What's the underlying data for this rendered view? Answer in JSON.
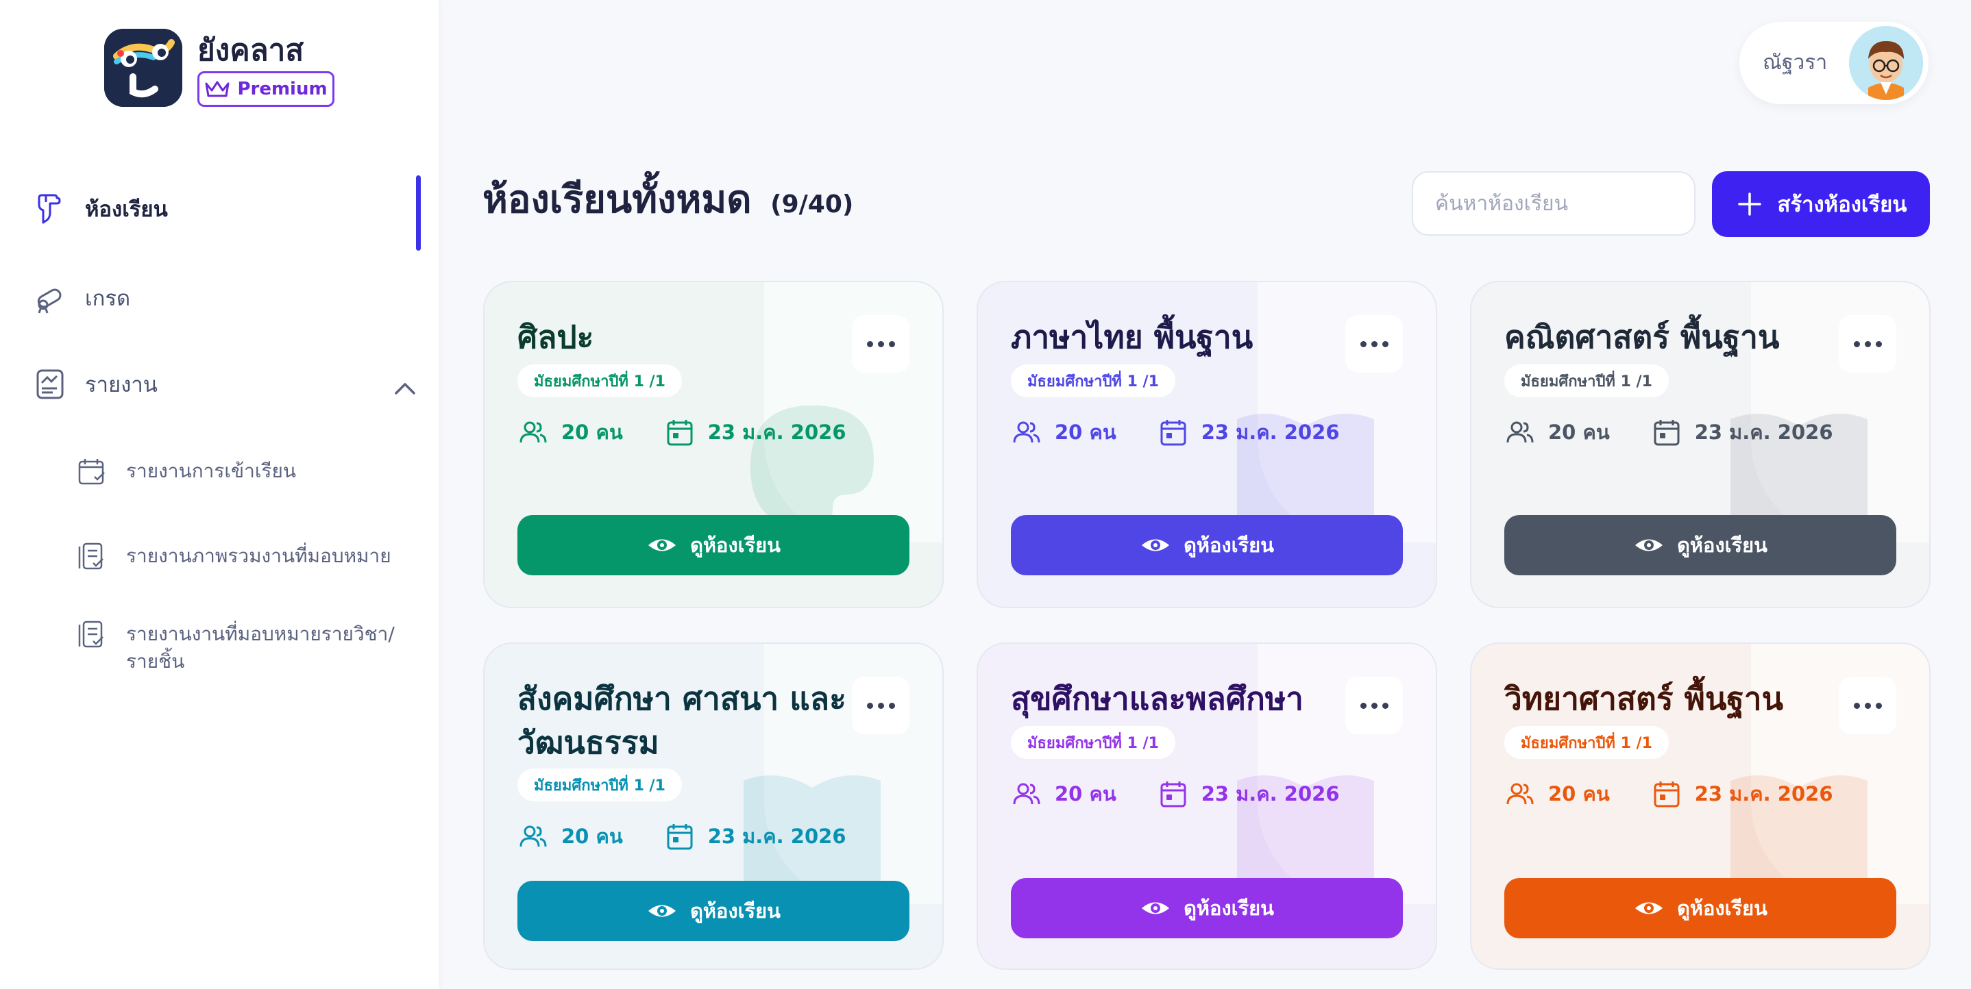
{
  "brand": {
    "name": "ยังคลาส",
    "badge": "Premium"
  },
  "nav": {
    "items": [
      {
        "label": "ห้องเรียน",
        "icon": "hand-pointer-icon",
        "active": true
      },
      {
        "label": "เกรด",
        "icon": "diploma-icon"
      },
      {
        "label": "รายงาน",
        "icon": "report-chart-icon"
      }
    ],
    "report_subitems": [
      {
        "label": "รายงานการเข้าเรียน",
        "icon": "calendar-check-icon"
      },
      {
        "label": "รายงานภาพรวมงานที่มอบหมาย",
        "icon": "clipboard-check-icon"
      },
      {
        "label": "รายงานงานที่มอบหมายรายวิชา/",
        "label2": "รายชิ้น",
        "icon": "clipboard-check-icon"
      }
    ]
  },
  "user": {
    "name": "ณัฐวรา",
    "avatar_icon": "boy-avatar-icon"
  },
  "header": {
    "title": "ห้องเรียนทั้งหมด",
    "count": "(9/40)",
    "search_placeholder": "ค้นหาห้องเรียน",
    "create_label": "สร้างห้องเรียน"
  },
  "classes": [
    {
      "title": "ศิลปะ",
      "grade": "มัธยมศึกษาปีที่ 1 /1",
      "students": "20 คน",
      "date": "23 ม.ค. 2026",
      "button": "ดูห้องเรียน",
      "accent": "#059669",
      "text": "#0b3b2e",
      "bg": "#eef5f3",
      "watermark": "palette-icon"
    },
    {
      "title": "ภาษาไทย พื้นฐาน",
      "grade": "มัธยมศึกษาปีที่ 1 /1",
      "students": "20 คน",
      "date": "23 ม.ค. 2026",
      "button": "ดูห้องเรียน",
      "accent": "#4f46e5",
      "text": "#1e1b4b",
      "bg": "#f1f1fb",
      "watermark": "book-icon"
    },
    {
      "title": "คณิตศาสตร์ พื้นฐาน",
      "grade": "มัธยมศึกษาปีที่ 1 /1",
      "students": "20 คน",
      "date": "23 ม.ค. 2026",
      "button": "ดูห้องเรียน",
      "accent": "#4b5563",
      "text": "#1f2937",
      "bg": "#f3f4f6",
      "watermark": "book-icon"
    },
    {
      "title": "สังคมศึกษา ศาสนา และวัฒนธรรม",
      "grade": "มัธยมศึกษาปีที่ 1 /1",
      "students": "20 คน",
      "date": "23 ม.ค. 2026",
      "button": "ดูห้องเรียน",
      "accent": "#0891b2",
      "text": "#0c3340",
      "bg": "#eef4f7",
      "watermark": "book-icon"
    },
    {
      "title": "สุขศึกษาและพลศึกษา",
      "grade": "มัธยมศึกษาปีที่ 1 /1",
      "students": "20 คน",
      "date": "23 ม.ค. 2026",
      "button": "ดูห้องเรียน",
      "accent": "#9333ea",
      "text": "#2e1065",
      "bg": "#f4f0fb",
      "watermark": "book-icon"
    },
    {
      "title": "วิทยาศาสตร์ พื้นฐาน",
      "grade": "มัธยมศึกษาปีที่ 1 /1",
      "students": "20 คน",
      "date": "23 ม.ค. 2026",
      "button": "ดูห้องเรียน",
      "accent": "#ea580c",
      "text": "#431407",
      "bg": "#f8f1ee",
      "watermark": "book-icon"
    }
  ]
}
